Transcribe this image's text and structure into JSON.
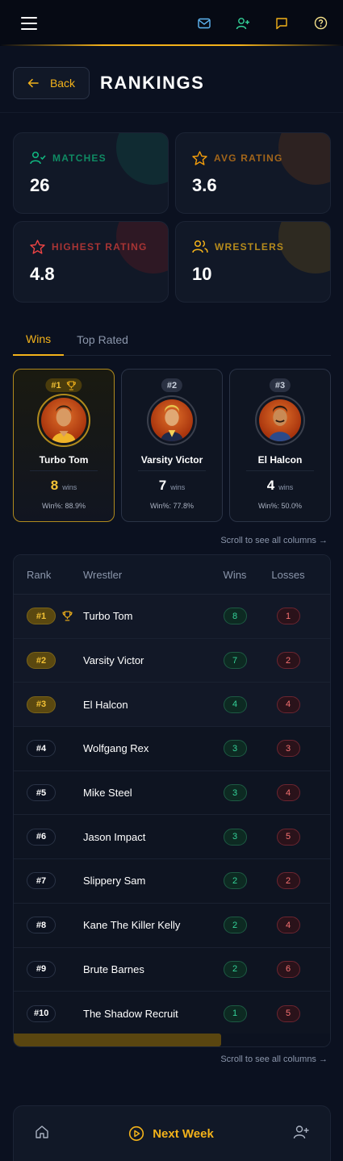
{
  "nav": {
    "icons": [
      "menu-icon",
      "mail-icon",
      "user-plus-icon",
      "chat-icon",
      "help-icon"
    ]
  },
  "header": {
    "back_label": "Back",
    "title": "RANKINGS"
  },
  "stats": [
    {
      "label": "MATCHES",
      "value": "26",
      "color": "#10b981",
      "icon": "user-check-icon"
    },
    {
      "label": "AVG RATING",
      "value": "3.6",
      "color": "#f59e0b",
      "icon": "star-icon"
    },
    {
      "label": "HIGHEST RATING",
      "value": "4.8",
      "color": "#ef4444",
      "icon": "star-icon"
    },
    {
      "label": "WRESTLERS",
      "value": "10",
      "color": "#f3b21a",
      "icon": "users-icon"
    }
  ],
  "tabs": [
    {
      "label": "Wins",
      "active": true
    },
    {
      "label": "Top Rated",
      "active": false
    }
  ],
  "podium": [
    {
      "rank": "#1",
      "name": "Turbo Tom",
      "wins": "8",
      "wins_label": "wins",
      "winpct": "Win%: 88.9%"
    },
    {
      "rank": "#2",
      "name": "Varsity Victor",
      "wins": "7",
      "wins_label": "wins",
      "winpct": "Win%: 77.8%"
    },
    {
      "rank": "#3",
      "name": "El Halcon",
      "wins": "4",
      "wins_label": "wins",
      "winpct": "Win%: 50.0%"
    }
  ],
  "scroll_hint": "Scroll to see all columns →",
  "table": {
    "headers": {
      "rank": "Rank",
      "wrestler": "Wrestler",
      "wins": "Wins",
      "losses": "Losses"
    },
    "rows": [
      {
        "rank": "#1",
        "name": "Turbo Tom",
        "wins": "8",
        "losses": "1"
      },
      {
        "rank": "#2",
        "name": "Varsity Victor",
        "wins": "7",
        "losses": "2"
      },
      {
        "rank": "#3",
        "name": "El Halcon",
        "wins": "4",
        "losses": "4"
      },
      {
        "rank": "#4",
        "name": "Wolfgang Rex",
        "wins": "3",
        "losses": "3"
      },
      {
        "rank": "#5",
        "name": "Mike Steel",
        "wins": "3",
        "losses": "4"
      },
      {
        "rank": "#6",
        "name": "Jason Impact",
        "wins": "3",
        "losses": "5"
      },
      {
        "rank": "#7",
        "name": "Slippery Sam",
        "wins": "2",
        "losses": "2"
      },
      {
        "rank": "#8",
        "name": "Kane The Killer Kelly",
        "wins": "2",
        "losses": "4"
      },
      {
        "rank": "#9",
        "name": "Brute Barnes",
        "wins": "2",
        "losses": "6"
      },
      {
        "rank": "#10",
        "name": "The Shadow Recruit",
        "wins": "1",
        "losses": "5"
      }
    ]
  },
  "bottom_nav": {
    "next_label": "Next Week"
  },
  "colors": {
    "accent": "#f3b21a",
    "bg": "#0b1120",
    "win": "#34d399",
    "loss": "#f87171"
  }
}
